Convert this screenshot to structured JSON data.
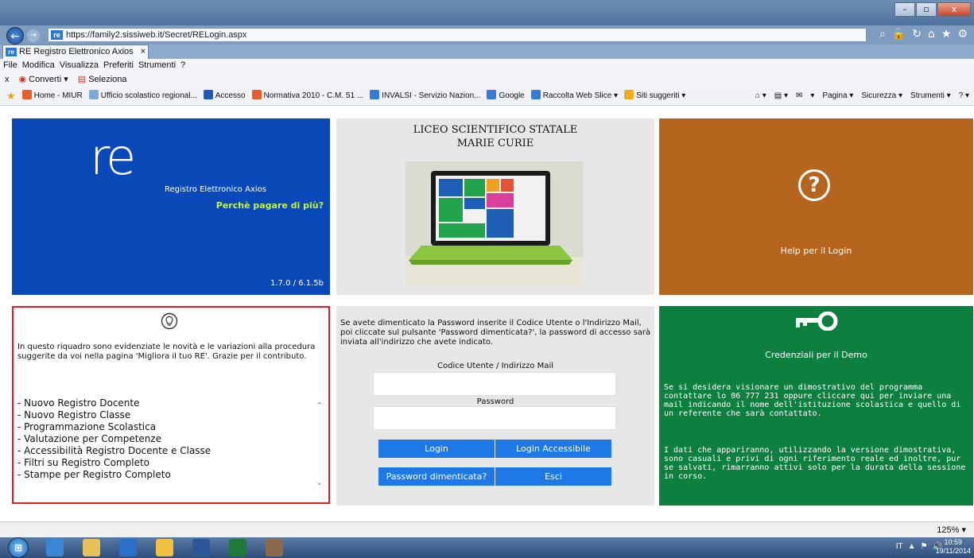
{
  "browser": {
    "url": "https://family2.sissiweb.it/Secret/RELogin.aspx",
    "tab_title": "RE Registro Elettronico Axios",
    "tab_close": "×",
    "site_icon_text": "re",
    "nav_back_glyph": "←",
    "nav_forward_glyph": "→",
    "addr_icons": [
      "⌕",
      "🔒",
      "↻",
      "⌂",
      "★",
      "⚙"
    ],
    "window_buttons": [
      "–",
      "▫",
      "x"
    ],
    "menu": [
      "File",
      "Modifica",
      "Visualizza",
      "Preferiti",
      "Strumenti",
      "?"
    ],
    "cmdbar": {
      "close": "x",
      "convert": "Converti",
      "select": "Seleziona"
    },
    "favorites": [
      "Home - MIUR",
      "Ufficio scolastico regional...",
      "Accesso",
      "Normativa 2010 - C.M. 51 ...",
      "INVALSI - Servizio Nazion...",
      "Google",
      "Raccolta Web Slice ▾",
      "Siti suggeriti ▾"
    ],
    "favorites_right": [
      "⌂ ▾",
      "▤ ▾",
      "✉",
      "▾",
      "Pagina ▾",
      "Sicurezza ▾",
      "Strumenti ▾",
      "? ▾"
    ],
    "zoom": "125%  ▾"
  },
  "re_tile": {
    "logo": "re",
    "subtitle": "Registro Elettronico Axios",
    "slogan": "Perchè pagare di più?",
    "version": "1.7.0 / 6.1.5b"
  },
  "school": {
    "line1": "LICEO SCIENTIFICO STATALE",
    "line2": "MARIE CURIE"
  },
  "help": {
    "icon_glyph": "?",
    "label": "Help per il Login"
  },
  "news": {
    "intro": "In questo riquadro sono evidenziate le novità e le variazioni alla procedura suggerite da voi nella pagina 'Migliora il tuo RE'. Grazie per il contributo.",
    "items": [
      "- Nuovo Registro Docente",
      "- Nuovo Registro Classe",
      "- Programmazione Scolastica",
      "- Valutazione per Competenze",
      "- Accessibilità Registro Docente e Classe",
      "- Filtri su Registro Completo",
      "- Stampe per Registro Completo"
    ],
    "scroll_up": "⌃",
    "scroll_down": "⌄"
  },
  "login": {
    "info": "Se avete dimenticato la Password inserite il Codice Utente o l'Indirizzo Mail, poi cliccate sul pulsante 'Password dimenticata?', la password di accesso sarà inviata all'indirizzo che avete indicato.",
    "user_label": "Codice Utente / Indirizzo Mail",
    "user_value": "",
    "password_label": "Password",
    "password_value": "",
    "btn_login": "Login",
    "btn_login_accessible": "Login Accessibile",
    "btn_forgot": "Password dimenticata?",
    "btn_exit": "Esci"
  },
  "demo": {
    "title": "Credenziali per il Demo",
    "p1": "Se si desidera visionare un dimostrativo del programma contattare lo 06 777 231 oppure cliccare qui per inviare una mail indicando il nome dell'istituzione scolastica e quello di un referente che sarà contattato.",
    "p2": "I dati che appariranno, utilizzando la versione dimostrativa, sono casuali e privi di ogni riferimento reale ed inoltre, pur se salvati, rimarranno attivi solo per la durata della sessione in corso."
  },
  "taskbar": {
    "start_glyph": "⊞",
    "tray": [
      "IT",
      "▲",
      "⚑",
      "🔊"
    ],
    "time": "10:59",
    "date": "19/11/2014"
  },
  "colors": {
    "re_blue": "#0a4ab8",
    "help_orange": "#b5651d",
    "demo_green": "#0d7f3e",
    "news_border": "#d81f2a",
    "button_blue": "#1e78e6",
    "slogan_green": "#c8f04a"
  }
}
